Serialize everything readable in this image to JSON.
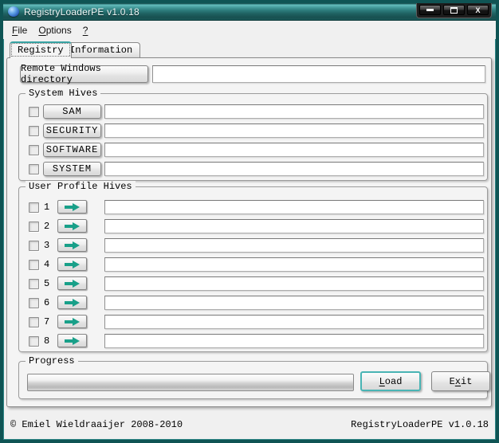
{
  "window": {
    "title": "RegistryLoaderPE v1.0.18",
    "icon": "registry-app-icon",
    "controls": {
      "close_glyph": "X"
    }
  },
  "menu": {
    "items": [
      {
        "label": "File",
        "accel": 0
      },
      {
        "label": "Options",
        "accel": 0
      },
      {
        "label": "?",
        "accel": 0
      }
    ]
  },
  "tabs": {
    "registry": {
      "label": "Registry",
      "active": true
    },
    "information": {
      "label": "Information",
      "active": false
    }
  },
  "remote": {
    "button_label": "Remote Windows directory",
    "value": ""
  },
  "system_hives": {
    "title": "System Hives",
    "rows": [
      {
        "checked": false,
        "button": "SAM",
        "value": ""
      },
      {
        "checked": false,
        "button": "SECURITY",
        "value": ""
      },
      {
        "checked": false,
        "button": "SOFTWARE",
        "value": ""
      },
      {
        "checked": false,
        "button": "SYSTEM",
        "value": ""
      }
    ]
  },
  "user_profile_hives": {
    "title": "User Profile Hives",
    "rows": [
      {
        "num": "1",
        "checked": false,
        "value": ""
      },
      {
        "num": "2",
        "checked": false,
        "value": ""
      },
      {
        "num": "3",
        "checked": false,
        "value": ""
      },
      {
        "num": "4",
        "checked": false,
        "value": ""
      },
      {
        "num": "5",
        "checked": false,
        "value": ""
      },
      {
        "num": "6",
        "checked": false,
        "value": ""
      },
      {
        "num": "7",
        "checked": false,
        "value": ""
      },
      {
        "num": "8",
        "checked": false,
        "value": ""
      }
    ]
  },
  "progress": {
    "title": "Progress",
    "percent": 0,
    "load": {
      "label": "Load",
      "accel": 0
    },
    "exit": {
      "label": "Exit",
      "accel": 1
    }
  },
  "status_bar": {
    "left": "© Emiel Wieldraaijer 2008-2010",
    "right": "RegistryLoaderPE v1.0.18"
  },
  "colors": {
    "titlebar_teal": "#2f8080",
    "window_border": "#0f5454",
    "arrow_teal": "#18a089",
    "default_button_border": "#49b4b4"
  }
}
